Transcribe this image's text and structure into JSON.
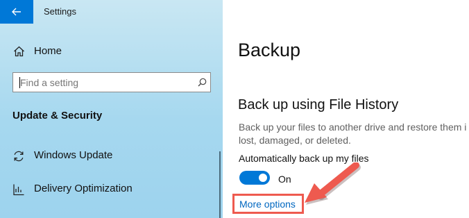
{
  "window": {
    "title": "Settings"
  },
  "sidebar": {
    "home_label": "Home",
    "search_placeholder": "Find a setting",
    "section_title": "Update & Security",
    "items": [
      {
        "label": "Windows Update",
        "icon": "refresh-icon"
      },
      {
        "label": "Delivery Optimization",
        "icon": "delivery-optimization-icon"
      }
    ]
  },
  "main": {
    "title": "Backup",
    "section_heading": "Back up using File History",
    "description_line1": "Back up your files to another drive and restore them i",
    "description_line2": "lost, damaged, or deleted.",
    "auto_backup_label": "Automatically back up my files",
    "toggle_state": "On",
    "toggle_on": true,
    "more_options_link": "More options"
  },
  "colors": {
    "accent": "#0078d7",
    "link": "#0067c0",
    "annotation": "#ee5a4f",
    "sidebar_bg": "#a6d8ef"
  },
  "icons": {
    "back": "back-arrow-icon",
    "home": "home-icon",
    "search": "search-icon",
    "annotation": "annotation-arrow-icon"
  }
}
